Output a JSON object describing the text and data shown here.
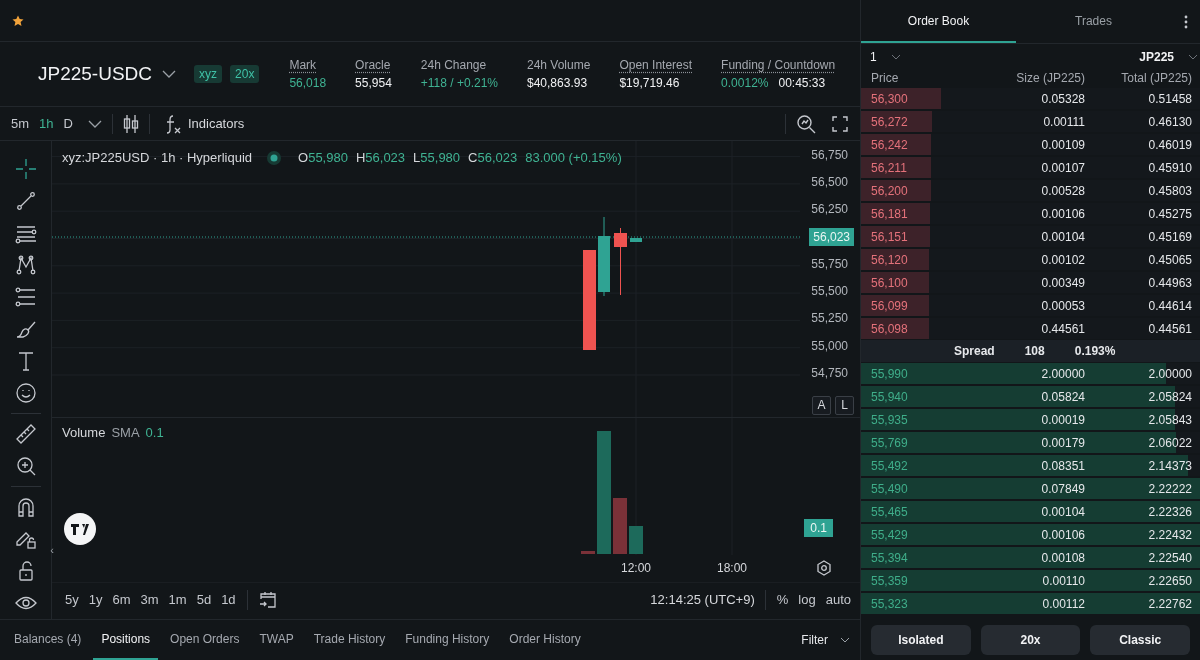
{
  "collapse_button": "‹",
  "market": {
    "symbol": "JP225-USDC",
    "badges": [
      "xyz",
      "20x"
    ]
  },
  "stats": [
    {
      "label": "Mark",
      "dotted": true,
      "values": [
        {
          "text": "56,018",
          "highlight": true
        }
      ]
    },
    {
      "label": "Oracle",
      "dotted": true,
      "values": [
        {
          "text": "55,954",
          "highlight": false
        }
      ]
    },
    {
      "label": "24h Change",
      "dotted": false,
      "values": [
        {
          "text": "+118 / +0.21%",
          "highlight": true
        }
      ]
    },
    {
      "label": "24h Volume",
      "dotted": false,
      "values": [
        {
          "text": "$40,863.93",
          "highlight": false
        }
      ]
    },
    {
      "label": "Open Interest",
      "dotted": true,
      "values": [
        {
          "text": "$19,719.46",
          "highlight": false
        }
      ]
    },
    {
      "label": "Funding / Countdown",
      "dotted": true,
      "values": [
        {
          "text": "0.0012%",
          "highlight": true
        },
        {
          "text": "00:45:33",
          "highlight": false
        }
      ]
    }
  ],
  "chart": {
    "timeframes": [
      {
        "label": "5m",
        "selected": false
      },
      {
        "label": "1h",
        "selected": true
      },
      {
        "label": "D",
        "selected": false
      }
    ],
    "indicators_button": "Indicators",
    "tool_groups": [
      [
        {
          "kind": "crosshair",
          "selected": true
        },
        {
          "kind": "trendline",
          "selected": false
        },
        {
          "kind": "fib",
          "selected": false
        },
        {
          "kind": "pattern",
          "selected": false
        },
        {
          "kind": "channel",
          "selected": false
        },
        {
          "kind": "brush",
          "selected": false
        },
        {
          "kind": "text",
          "selected": false
        },
        {
          "kind": "emoji",
          "selected": false
        }
      ],
      [
        {
          "kind": "ruler",
          "selected": false
        },
        {
          "kind": "zoom",
          "selected": false
        }
      ],
      [
        {
          "kind": "magnet",
          "selected": false
        },
        {
          "kind": "lock-draw",
          "selected": false
        },
        {
          "kind": "lock",
          "selected": false
        },
        {
          "kind": "eye",
          "selected": false
        }
      ]
    ],
    "legend": {
      "title": "xyz:JP225USD · 1h · Hyperliquid",
      "ohlc": [
        {
          "key": "O",
          "value": "55,980"
        },
        {
          "key": "H",
          "value": "56,023"
        },
        {
          "key": "L",
          "value": "55,980"
        },
        {
          "key": "C",
          "value": "56,023"
        }
      ],
      "change": "83.000 (+0.15%)"
    },
    "price_ticks": [
      {
        "label": "56,750",
        "kind": "tick"
      },
      {
        "label": "56,500",
        "kind": "tick"
      },
      {
        "label": "56,250",
        "kind": "tick"
      },
      {
        "label": "56,023",
        "kind": "last"
      },
      {
        "label": "55,750",
        "kind": "tick"
      },
      {
        "label": "55,500",
        "kind": "tick"
      },
      {
        "label": "55,250",
        "kind": "tick"
      },
      {
        "label": "55,000",
        "kind": "tick"
      },
      {
        "label": "54,750",
        "kind": "tick"
      }
    ],
    "scale_buttons": [
      "A",
      "L"
    ],
    "volume": {
      "label": "Volume",
      "indicator": "SMA",
      "value": "0.1",
      "axis_badge": "0.1"
    },
    "time_ticks": [
      "12:00",
      "18:00"
    ],
    "ranges": [
      "5y",
      "1y",
      "6m",
      "3m",
      "1m",
      "5d",
      "1d"
    ],
    "clock": "12:14:25 (UTC+9)",
    "scale_modes": [
      "%",
      "log",
      "auto"
    ]
  },
  "bottom_tabs": [
    {
      "label": "Balances (4)",
      "selected": false
    },
    {
      "label": "Positions",
      "selected": true
    },
    {
      "label": "Open Orders",
      "selected": false
    },
    {
      "label": "TWAP",
      "selected": false
    },
    {
      "label": "Trade History",
      "selected": false
    },
    {
      "label": "Funding History",
      "selected": false
    },
    {
      "label": "Order History",
      "selected": false
    }
  ],
  "filter": "Filter",
  "order_book": {
    "tabs": [
      {
        "label": "Order Book",
        "selected": true
      },
      {
        "label": "Trades",
        "selected": false
      }
    ],
    "grouping": "1",
    "unit": "JP225",
    "columns": [
      "Price",
      "Size (JP225)",
      "Total (JP225)"
    ],
    "asks": [
      {
        "price": "56,300",
        "size": "0.05328",
        "total": "0.51458",
        "level": 0.235
      },
      {
        "price": "56,272",
        "size": "0.00111",
        "total": "0.46130",
        "level": 0.21
      },
      {
        "price": "56,242",
        "size": "0.00109",
        "total": "0.46019",
        "level": 0.207
      },
      {
        "price": "56,211",
        "size": "0.00107",
        "total": "0.45910",
        "level": 0.207
      },
      {
        "price": "56,200",
        "size": "0.00528",
        "total": "0.45803",
        "level": 0.206
      },
      {
        "price": "56,181",
        "size": "0.00106",
        "total": "0.45275",
        "level": 0.203
      },
      {
        "price": "56,151",
        "size": "0.00104",
        "total": "0.45169",
        "level": 0.203
      },
      {
        "price": "56,120",
        "size": "0.00102",
        "total": "0.45065",
        "level": 0.202
      },
      {
        "price": "56,100",
        "size": "0.00349",
        "total": "0.44963",
        "level": 0.202
      },
      {
        "price": "56,099",
        "size": "0.00053",
        "total": "0.44614",
        "level": 0.2
      },
      {
        "price": "56,098",
        "size": "0.44561",
        "total": "0.44561",
        "level": 0.2
      }
    ],
    "spread": {
      "label": "Spread",
      "value": "108",
      "percent": "0.193%"
    },
    "bids": [
      {
        "price": "55,990",
        "size": "2.00000",
        "total": "2.00000",
        "level": 0.9
      },
      {
        "price": "55,940",
        "size": "0.05824",
        "total": "2.05824",
        "level": 0.925
      },
      {
        "price": "55,935",
        "size": "0.00019",
        "total": "2.05843",
        "level": 0.925
      },
      {
        "price": "55,769",
        "size": "0.00179",
        "total": "2.06022",
        "level": 0.93
      },
      {
        "price": "55,492",
        "size": "0.08351",
        "total": "2.14373",
        "level": 0.965
      },
      {
        "price": "55,490",
        "size": "0.07849",
        "total": "2.22222",
        "level": 1
      },
      {
        "price": "55,465",
        "size": "0.00104",
        "total": "2.22326",
        "level": 1
      },
      {
        "price": "55,429",
        "size": "0.00106",
        "total": "2.22432",
        "level": 1
      },
      {
        "price": "55,394",
        "size": "0.00108",
        "total": "2.22540",
        "level": 1
      },
      {
        "price": "55,359",
        "size": "0.00110",
        "total": "2.22650",
        "level": 1
      },
      {
        "price": "55,323",
        "size": "0.00112",
        "total": "2.22762",
        "level": 1
      }
    ]
  },
  "buttons": [
    "Isolated",
    "20x",
    "Classic"
  ]
}
